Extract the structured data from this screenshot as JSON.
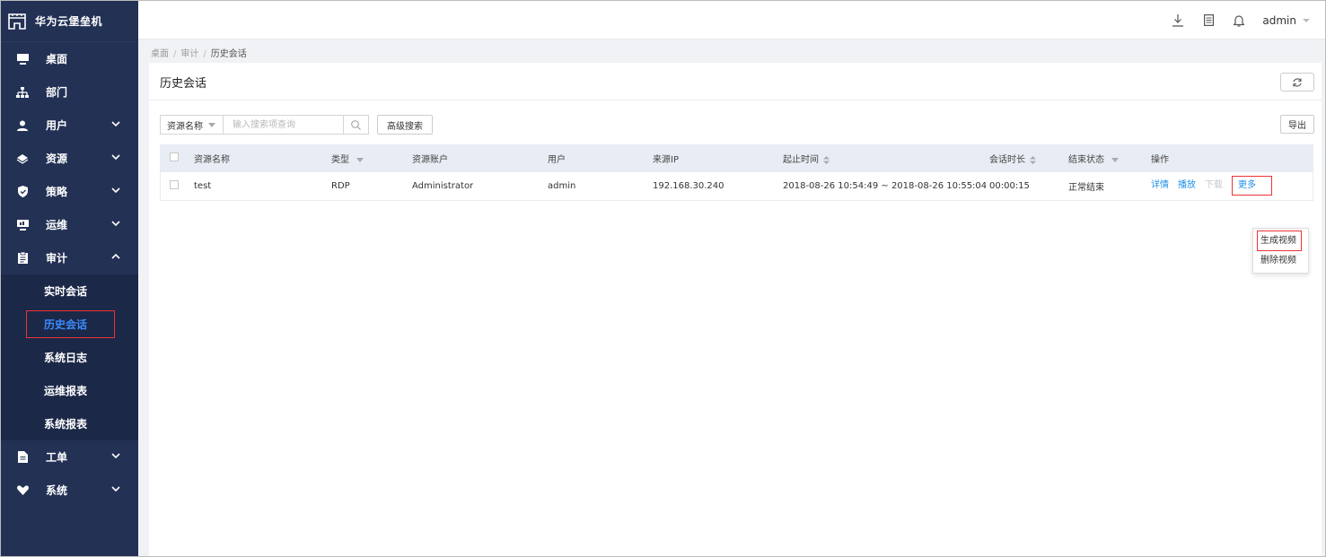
{
  "app": {
    "title": "华为云堡垒机"
  },
  "header": {
    "user": "admin"
  },
  "sidebar": {
    "items": [
      {
        "label": "桌面",
        "icon": "monitor-icon"
      },
      {
        "label": "部门",
        "icon": "org-tree-icon"
      },
      {
        "label": "用户",
        "icon": "user-icon"
      },
      {
        "label": "资源",
        "icon": "layers-icon"
      },
      {
        "label": "策略",
        "icon": "shield-icon"
      },
      {
        "label": "运维",
        "icon": "ops-icon"
      },
      {
        "label": "审计",
        "icon": "audit-icon"
      },
      {
        "label": "工单",
        "icon": "document-icon"
      },
      {
        "label": "系统",
        "icon": "heart-icon"
      }
    ],
    "audit_sub": [
      {
        "label": "实时会话"
      },
      {
        "label": "历史会话"
      },
      {
        "label": "系统日志"
      },
      {
        "label": "运维报表"
      },
      {
        "label": "系统报表"
      }
    ]
  },
  "breadcrumb": {
    "home": "桌面",
    "section": "审计",
    "current": "历史会话"
  },
  "page": {
    "title": "历史会话"
  },
  "toolbar": {
    "filter_select": "资源名称",
    "search_placeholder": "输入搜索项查询",
    "advanced_search": "高级搜索",
    "export": "导出"
  },
  "table": {
    "headers": {
      "resource_name": "资源名称",
      "type": "类型",
      "account": "资源账户",
      "user": "用户",
      "source_ip": "来源IP",
      "time_range": "起止时间",
      "duration": "会话时长",
      "end_status": "结束状态",
      "actions": "操作"
    },
    "rows": [
      {
        "resource_name": "test",
        "type": "RDP",
        "account": "Administrator",
        "user": "admin",
        "source_ip": "192.168.30.240",
        "time_range": "2018-08-26 10:54:49 ~ 2018-08-26 10:55:04",
        "duration": "00:00:15",
        "end_status": "正常结束",
        "actions": {
          "detail": "详情",
          "play": "播放",
          "download": "下载",
          "more": "更多"
        }
      }
    ]
  },
  "more_menu": {
    "generate_video": "生成视频",
    "delete_video": "删除视频"
  },
  "colors": {
    "sidebar_bg": "#233155",
    "accent": "#1f8fe6",
    "highlight": "#ee3333"
  }
}
